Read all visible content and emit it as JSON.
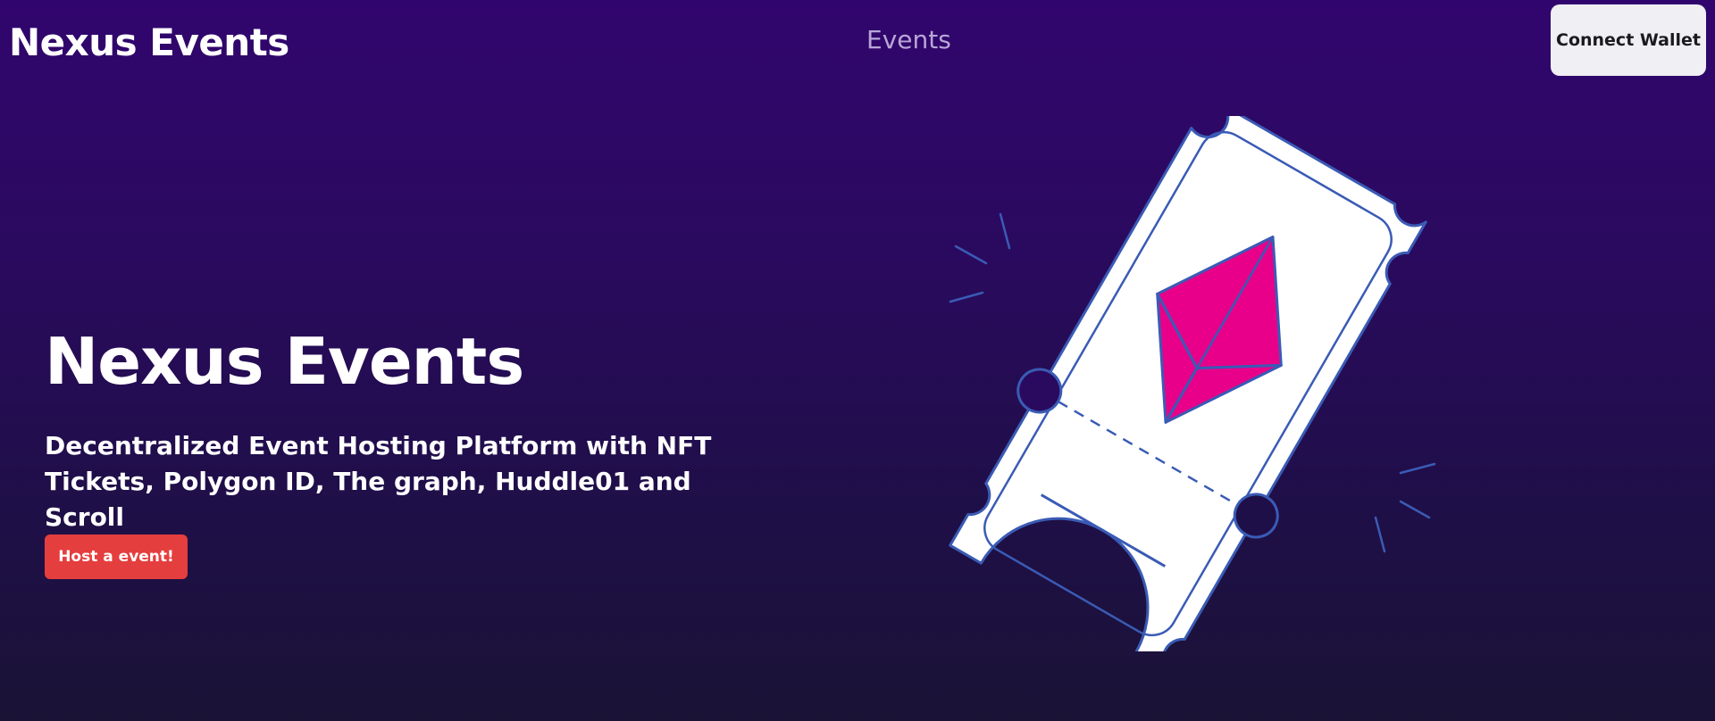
{
  "header": {
    "brand": "Nexus Events",
    "nav_events": "Events",
    "connect_label": "Connect Wallet"
  },
  "hero": {
    "title": "Nexus Events",
    "subtitle": "Decentralized Event Hosting Platform with NFT Tickets, Polygon ID, The graph, Huddle01 and Scroll",
    "cta_label": "Host a event!"
  },
  "illustration": {
    "name": "nft-ticket-illustration",
    "gem_color": "#e8008a",
    "outline_color": "#3a5bb5"
  },
  "colors": {
    "background_top": "#31056e",
    "background_bottom": "#1a1336",
    "cta": "#e53e3e",
    "connect_bg": "#f0eff3"
  }
}
